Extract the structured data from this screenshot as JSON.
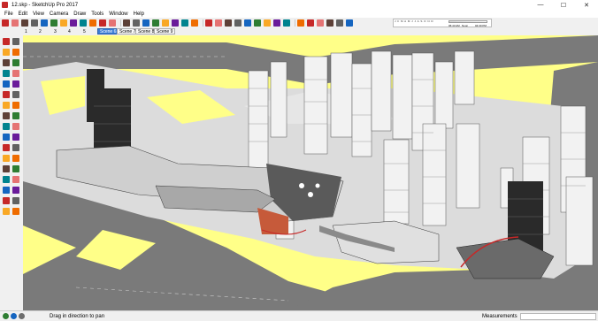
{
  "window": {
    "title": "12.skp - SketchUp Pro 2017",
    "minimize_glyph": "—",
    "maximize_glyph": "☐",
    "close_glyph": "✕"
  },
  "menubar": [
    "File",
    "Edit",
    "View",
    "Camera",
    "Draw",
    "Tools",
    "Window",
    "Help"
  ],
  "shadow_panel": {
    "months": "J F M A M J J A S O N D",
    "am": "06:43 AM",
    "noon": "Noon",
    "pm": "04:30 PM"
  },
  "scene_numbers": [
    "1",
    "2",
    "3",
    "4",
    "5"
  ],
  "scene_tabs": [
    {
      "label": "Scene 6",
      "active": true
    },
    {
      "label": "Scene 7",
      "active": false
    },
    {
      "label": "Scene 8",
      "active": false
    },
    {
      "label": "Scene 9",
      "active": false
    }
  ],
  "toolbar_icons": [
    "select-icon",
    "eraser-icon",
    "pencil-icon",
    "line-icon",
    "arc-icon",
    "shape-icon",
    "push-pull-icon",
    "move-icon",
    "rotate-icon",
    "scale-icon",
    "offset-icon",
    "tape-icon",
    "text-icon",
    "paint-icon",
    "orbit-icon",
    "pan-icon",
    "zoom-icon",
    "zoom-extents-icon",
    "warehouse-icon",
    "extension-icon",
    "component-icon",
    "layers-icon",
    "outliner-icon",
    "styles-icon",
    "scenes-icon",
    "shadows-icon",
    "fog-icon",
    "match-photo-icon",
    "section-icon",
    "xray-icon",
    "wireframe-icon",
    "hidden-line-icon",
    "shaded-icon",
    "textured-icon",
    "monochrome-icon"
  ],
  "left_tools": [
    "select-icon",
    "component-icon",
    "eraser-icon",
    "paint-icon",
    "line-icon",
    "freehand-icon",
    "rectangle-icon",
    "rotated-rect-icon",
    "circle-icon",
    "polygon-icon",
    "arc-icon",
    "pie-icon",
    "push-pull-icon",
    "follow-me-icon",
    "move-icon",
    "rotate-icon",
    "scale-icon",
    "offset-icon",
    "tape-icon",
    "dimension-icon",
    "protractor-icon",
    "text-icon",
    "axes-icon",
    "3d-text-icon",
    "orbit-icon",
    "pan-icon",
    "zoom-icon",
    "zoom-window-icon",
    "zoom-extents-icon",
    "previous-icon",
    "position-camera-icon",
    "look-around-icon",
    "walk-icon",
    "section-plane-icon"
  ],
  "status": {
    "message": "Drag in direction to pan",
    "measurements_label": "Measurements",
    "measurements_value": ""
  },
  "colors": {
    "ground_yellow": "#ffff88",
    "road_grey": "#7a7a7a",
    "pavement": "#dcdcdc",
    "building_white": "#f2f2f2",
    "building_dark": "#2a2a2a",
    "active_scene": "#3c7ed8"
  }
}
